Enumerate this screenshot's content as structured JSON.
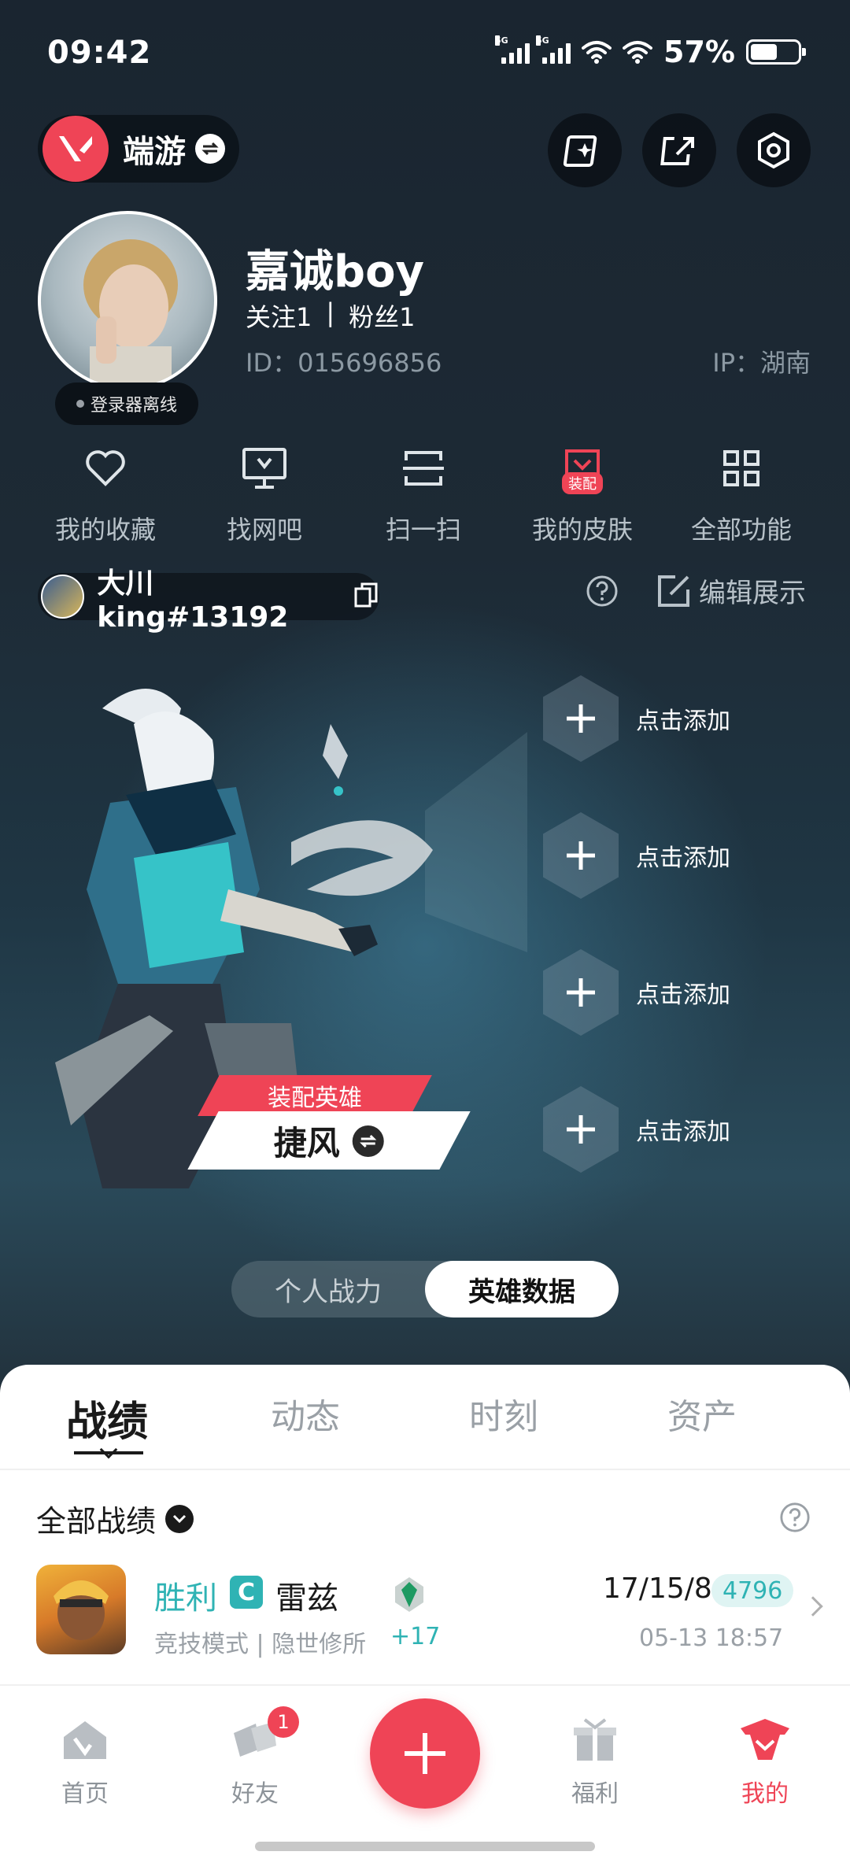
{
  "status_bar": {
    "time": "09:42",
    "signal_tag_1": "5G",
    "signal_tag_2": "5G",
    "battery_percent": "57%",
    "battery_level": 0.57
  },
  "header": {
    "game_name": "端游",
    "icons": [
      "star-edit-icon",
      "share-icon",
      "settings-hex-icon"
    ]
  },
  "profile": {
    "username": "嘉诚boy",
    "following": "关注1",
    "separator": "|",
    "followers": "粉丝1",
    "uid": "ID：015696856",
    "ip": "IP：湖南",
    "online_status": "登录器离线"
  },
  "quick_actions": [
    {
      "label": "我的收藏",
      "icon": "heart-icon"
    },
    {
      "label": "找网吧",
      "icon": "monitor-icon"
    },
    {
      "label": "扫一扫",
      "icon": "scan-icon"
    },
    {
      "label": "我的皮肤",
      "icon": "skin-icon",
      "badge": "装配"
    },
    {
      "label": "全部功能",
      "icon": "grid-icon"
    }
  ],
  "game_account": {
    "riot_id": "大川king#13192",
    "edit_label": "编辑展示"
  },
  "hero": {
    "tag_label": "装配英雄",
    "agent_name": "捷风"
  },
  "slots": [
    "点击添加",
    "点击添加",
    "点击添加",
    "点击添加"
  ],
  "toggle": {
    "left": "个人战力",
    "right": "英雄数据"
  },
  "tabs": [
    "战绩",
    "动态",
    "时刻",
    "资产"
  ],
  "records": {
    "filter_label": "全部战绩",
    "match": {
      "result": "胜利",
      "rank_letter": "C",
      "agent": "雷兹",
      "mode": "竞技模式 | 隐世修所",
      "rank_delta": "+17",
      "kda": "17/15/8",
      "score": "4796",
      "time": "05-13 18:57"
    }
  },
  "bottom_nav": [
    {
      "label": "首页",
      "icon": "home-icon"
    },
    {
      "label": "好友",
      "icon": "friends-icon",
      "badge": "1"
    },
    {
      "label": "福利",
      "icon": "gift-icon"
    },
    {
      "label": "我的",
      "icon": "profile-agent-icon"
    }
  ],
  "colors": {
    "accent": "#ef4456",
    "teal": "#2fb3b4",
    "dark_bg": "#1b2630"
  }
}
